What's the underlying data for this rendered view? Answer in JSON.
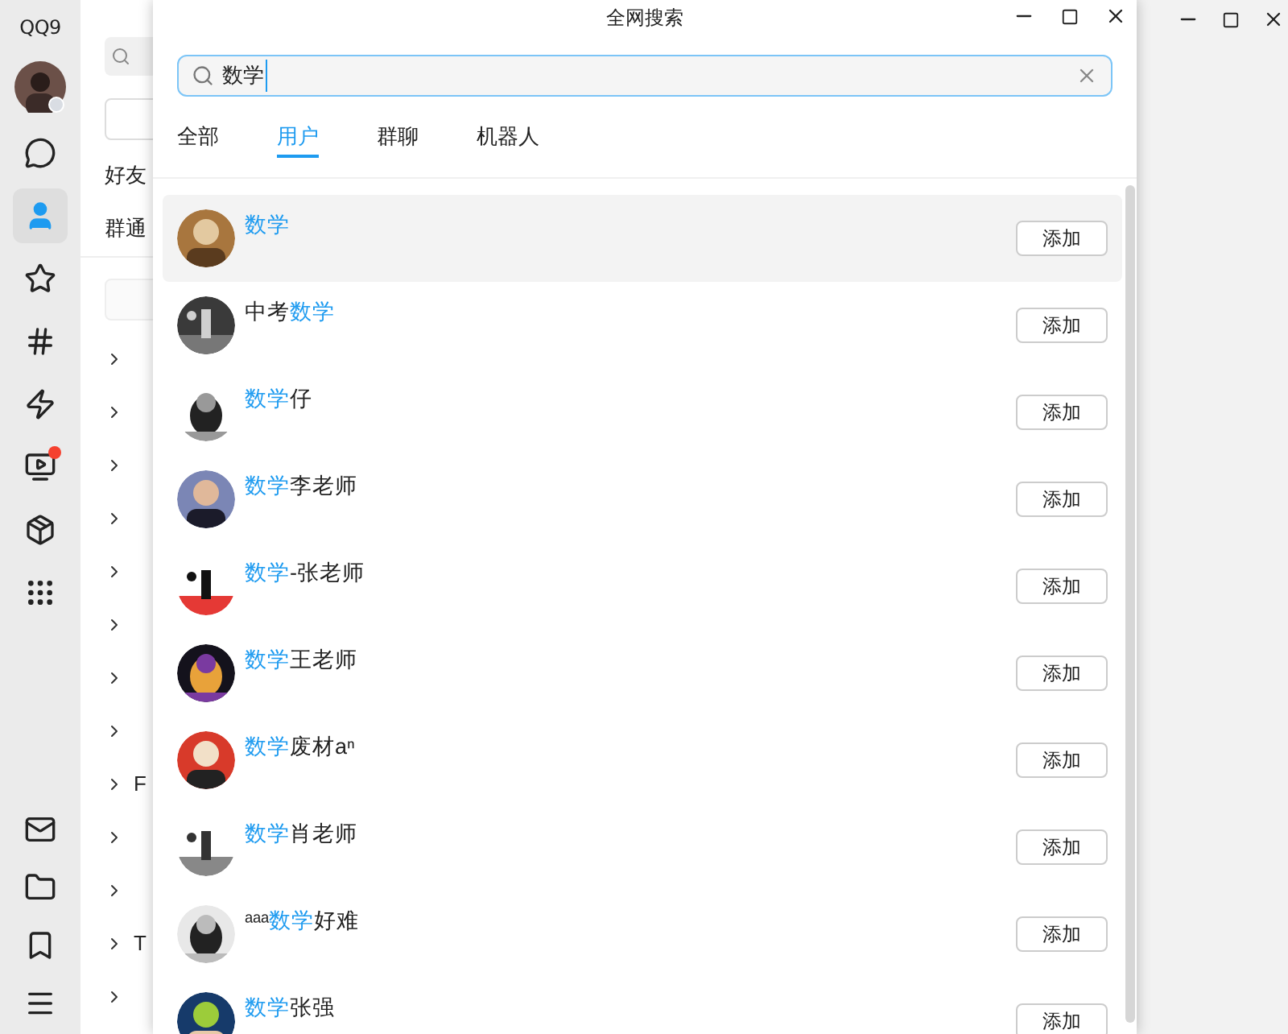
{
  "background_app": {
    "logo": "QQ9",
    "nav": [
      {
        "kind": "chat",
        "selected": false,
        "badge": false
      },
      {
        "kind": "contacts",
        "selected": true,
        "badge": false
      },
      {
        "kind": "star",
        "selected": false,
        "badge": false
      },
      {
        "kind": "hash",
        "selected": false,
        "badge": false
      },
      {
        "kind": "bolt",
        "selected": false,
        "badge": false
      },
      {
        "kind": "video",
        "selected": false,
        "badge": true
      },
      {
        "kind": "box",
        "selected": false,
        "badge": false
      },
      {
        "kind": "apps",
        "selected": false,
        "badge": false
      }
    ],
    "bottom_nav": [
      {
        "kind": "mail"
      },
      {
        "kind": "folder"
      },
      {
        "kind": "bookmark"
      },
      {
        "kind": "menu"
      }
    ],
    "contact_tabs": [
      {
        "label": "好友"
      },
      {
        "label": "群通"
      }
    ],
    "groups": [
      {
        "expanded": false
      },
      {
        "expanded": false
      },
      {
        "expanded": false
      },
      {
        "expanded": false
      },
      {
        "expanded": false
      },
      {
        "expanded": false
      },
      {
        "expanded": false
      },
      {
        "expanded": false
      },
      {
        "expanded": false,
        "label": "F"
      },
      {
        "expanded": false
      },
      {
        "expanded": false
      },
      {
        "expanded": false,
        "label": "T"
      },
      {
        "expanded": false
      }
    ]
  },
  "dialog": {
    "title": "全网搜索",
    "search": {
      "value": "数学"
    },
    "tabs": [
      {
        "label": "全部",
        "selected": false
      },
      {
        "label": "用户",
        "selected": true
      },
      {
        "label": "群聊",
        "selected": false
      },
      {
        "label": "机器人",
        "selected": false
      }
    ],
    "results": [
      {
        "name": [
          {
            "text": "数学",
            "match": true
          }
        ],
        "hovered": true,
        "button": "添加"
      },
      {
        "name": [
          {
            "text": "中考",
            "match": false
          },
          {
            "text": "数学",
            "match": true
          }
        ],
        "hovered": false,
        "button": "添加"
      },
      {
        "name": [
          {
            "text": "数学",
            "match": true
          },
          {
            "text": "仔",
            "match": false
          }
        ],
        "hovered": false,
        "button": "添加"
      },
      {
        "name": [
          {
            "text": "数学",
            "match": true
          },
          {
            "text": "李老师",
            "match": false
          }
        ],
        "hovered": false,
        "button": "添加"
      },
      {
        "name": [
          {
            "text": "数学",
            "match": true
          },
          {
            "text": "-张老师",
            "match": false
          }
        ],
        "hovered": false,
        "button": "添加"
      },
      {
        "name": [
          {
            "text": "数学",
            "match": true
          },
          {
            "text": "王老师",
            "match": false
          }
        ],
        "hovered": false,
        "button": "添加"
      },
      {
        "name": [
          {
            "text": "数学",
            "match": true
          },
          {
            "text": "废材aⁿ",
            "match": false
          }
        ],
        "hovered": false,
        "button": "添加"
      },
      {
        "name": [
          {
            "text": "数学",
            "match": true
          },
          {
            "text": "肖老师",
            "match": false
          }
        ],
        "hovered": false,
        "button": "添加"
      },
      {
        "name": [
          {
            "text": "ᵃᵃᵃ",
            "match": false
          },
          {
            "text": "数学",
            "match": true
          },
          {
            "text": "好难",
            "match": false
          }
        ],
        "hovered": false,
        "button": "添加"
      },
      {
        "name": [
          {
            "text": "数学",
            "match": true
          },
          {
            "text": "张强",
            "match": false
          }
        ],
        "hovered": false,
        "button": "添加"
      }
    ]
  }
}
